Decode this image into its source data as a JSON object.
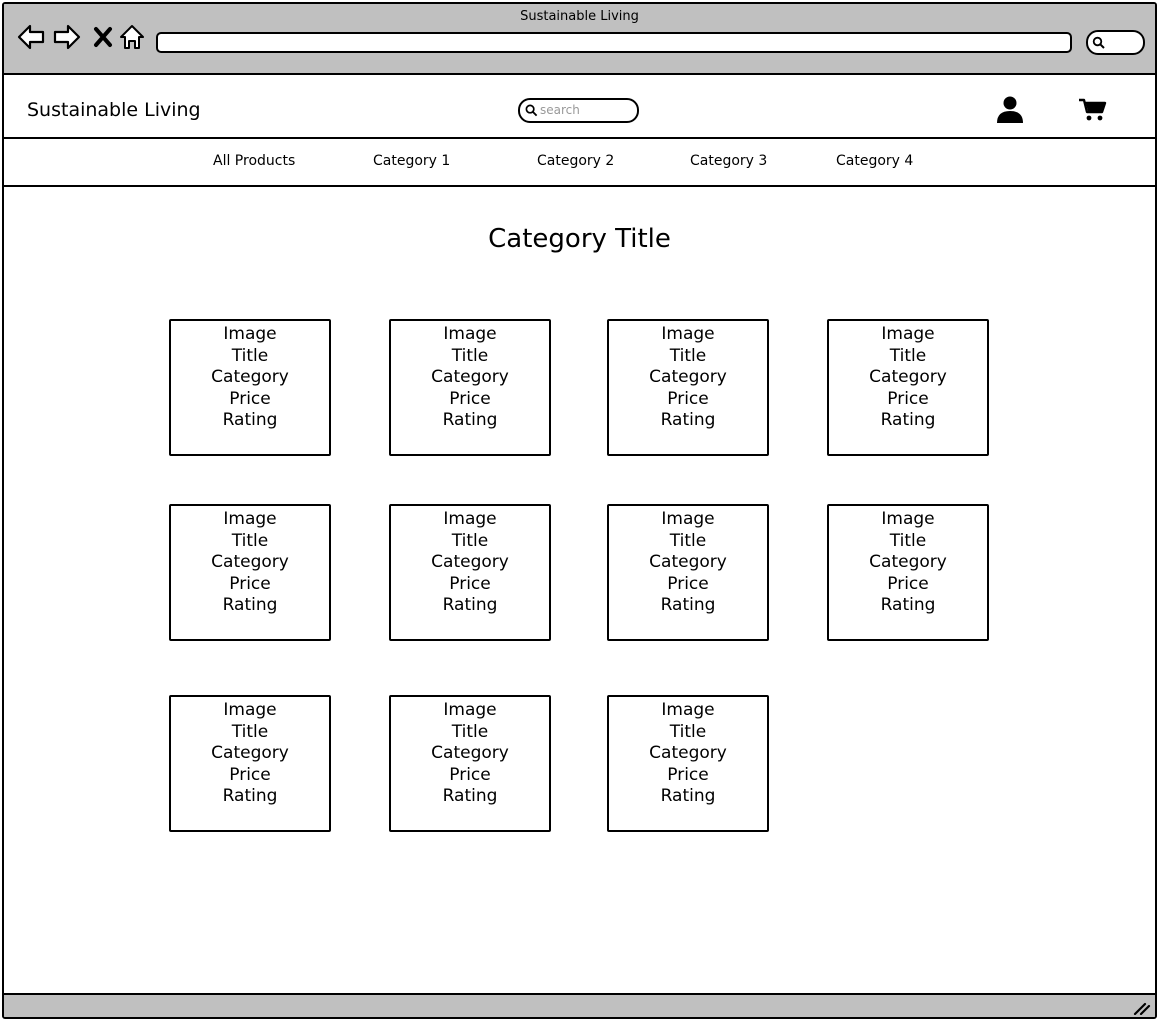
{
  "window": {
    "title": "Sustainable Living",
    "address": ""
  },
  "header": {
    "brand": "Sustainable Living",
    "search_placeholder": "search"
  },
  "nav": {
    "items": [
      "All Products",
      "Category 1",
      "Category 2",
      "Category 3",
      "Category 4"
    ]
  },
  "main": {
    "title": "Category Title",
    "products": [
      {
        "image": "Image",
        "title": "Title",
        "category": "Category",
        "price": "Price",
        "rating": "Rating"
      },
      {
        "image": "Image",
        "title": "Title",
        "category": "Category",
        "price": "Price",
        "rating": "Rating"
      },
      {
        "image": "Image",
        "title": "Title",
        "category": "Category",
        "price": "Price",
        "rating": "Rating"
      },
      {
        "image": "Image",
        "title": "Title",
        "category": "Category",
        "price": "Price",
        "rating": "Rating"
      },
      {
        "image": "Image",
        "title": "Title",
        "category": "Category",
        "price": "Price",
        "rating": "Rating"
      },
      {
        "image": "Image",
        "title": "Title",
        "category": "Category",
        "price": "Price",
        "rating": "Rating"
      },
      {
        "image": "Image",
        "title": "Title",
        "category": "Category",
        "price": "Price",
        "rating": "Rating"
      },
      {
        "image": "Image",
        "title": "Title",
        "category": "Category",
        "price": "Price",
        "rating": "Rating"
      },
      {
        "image": "Image",
        "title": "Title",
        "category": "Category",
        "price": "Price",
        "rating": "Rating"
      },
      {
        "image": "Image",
        "title": "Title",
        "category": "Category",
        "price": "Price",
        "rating": "Rating"
      },
      {
        "image": "Image",
        "title": "Title",
        "category": "Category",
        "price": "Price",
        "rating": "Rating"
      }
    ]
  },
  "icons": [
    "back-icon",
    "forward-icon",
    "stop-icon",
    "home-icon",
    "search-icon",
    "user-icon",
    "cart-icon",
    "resize-grip-icon"
  ]
}
